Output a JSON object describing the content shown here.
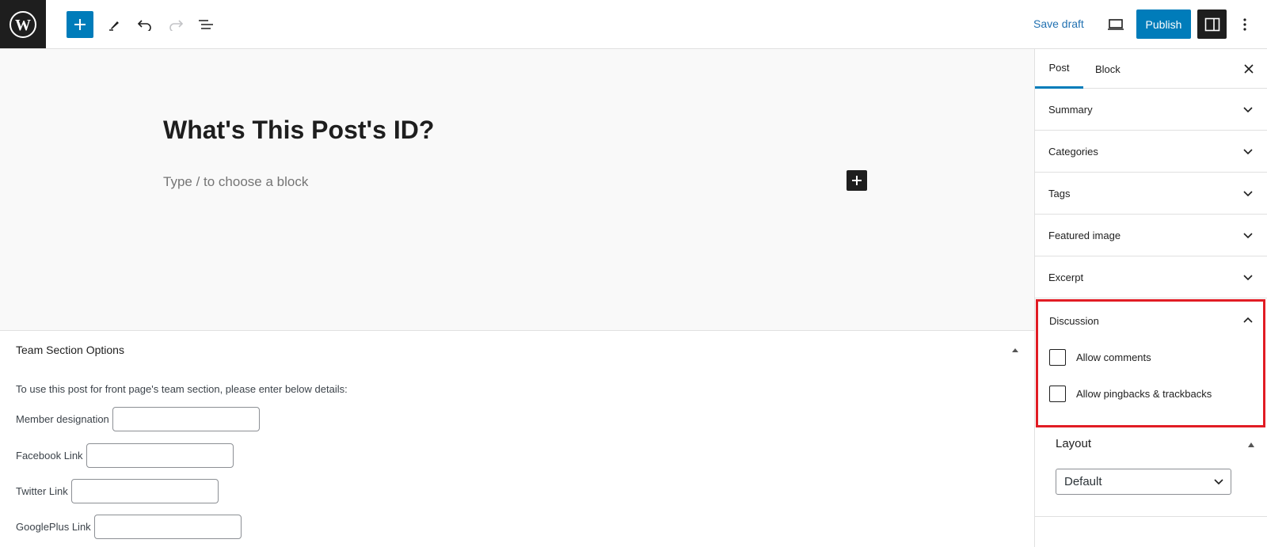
{
  "toolbar": {
    "save_draft": "Save draft",
    "publish": "Publish",
    "icons": [
      "wordpress-logo",
      "plus-icon",
      "pencil-icon",
      "undo-icon",
      "redo-icon",
      "list-view-icon",
      "desktop-preview-icon",
      "sidebar-toggle-icon",
      "more-vertical-icon"
    ]
  },
  "editor": {
    "title": "What's This Post's ID?",
    "placeholder": "Type / to choose a block"
  },
  "metabox": {
    "title": "Team Section Options",
    "description": "To use this post for front page's team section, please enter below details:",
    "fields": [
      {
        "label": "Member designation",
        "value": ""
      },
      {
        "label": "Facebook Link",
        "value": ""
      },
      {
        "label": "Twitter Link",
        "value": ""
      },
      {
        "label": "GooglePlus Link",
        "value": ""
      }
    ]
  },
  "sidebar": {
    "tabs": [
      "Post",
      "Block"
    ],
    "active_tab": "Post",
    "panels": [
      "Summary",
      "Categories",
      "Tags",
      "Featured image",
      "Excerpt"
    ],
    "discussion": {
      "label": "Discussion",
      "options": [
        {
          "label": "Allow comments",
          "checked": false
        },
        {
          "label": "Allow pingbacks & trackbacks",
          "checked": false
        }
      ]
    },
    "layout": {
      "title": "Layout",
      "selected": "Default"
    }
  },
  "colors": {
    "accent": "#007cba",
    "dark": "#1e1e1e",
    "highlight": "#e11c24"
  }
}
